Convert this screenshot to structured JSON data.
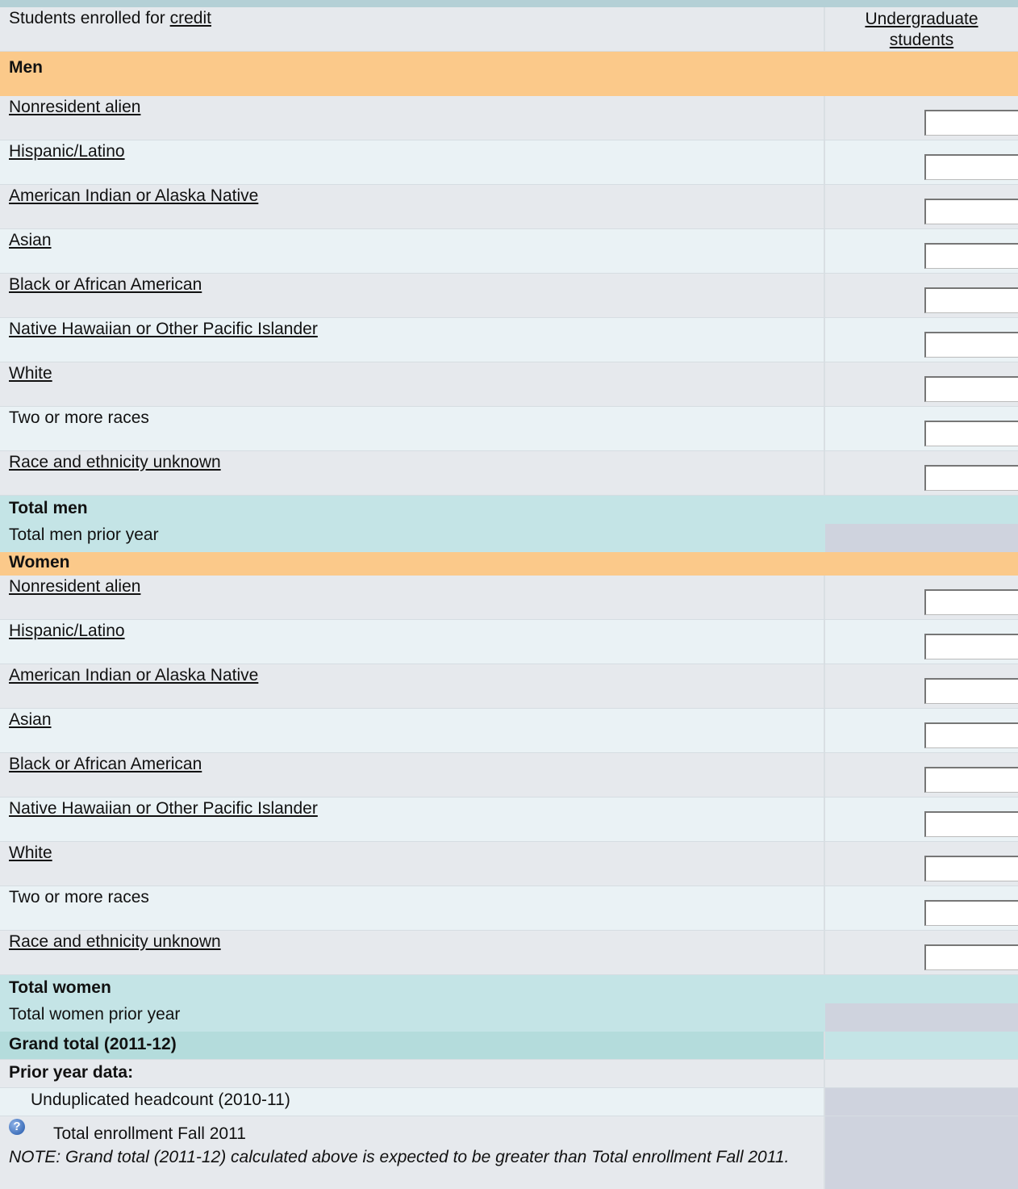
{
  "header": {
    "col1_prefix": "Students enrolled for ",
    "col1_link": "credit",
    "col2_line1": "Undergraduate",
    "col2_line2": "students"
  },
  "men": {
    "title": "Men",
    "rows": [
      {
        "label": "Nonresident alien",
        "linked": true
      },
      {
        "label": "Hispanic/Latino",
        "linked": true
      },
      {
        "label": "American Indian or Alaska Native",
        "linked": true
      },
      {
        "label": "Asian",
        "linked": true
      },
      {
        "label": "Black or African American",
        "linked": true
      },
      {
        "label": "Native Hawaiian or Other Pacific Islander",
        "linked": true
      },
      {
        "label": "White",
        "linked": true
      },
      {
        "label": "Two or more races",
        "linked": false
      },
      {
        "label": "Race and ethnicity unknown",
        "linked": true
      }
    ],
    "total_label": "Total men",
    "prior_label": "Total men prior year"
  },
  "women": {
    "title": "Women",
    "rows": [
      {
        "label": "Nonresident alien",
        "linked": true
      },
      {
        "label": "Hispanic/Latino",
        "linked": true
      },
      {
        "label": "American Indian or Alaska Native",
        "linked": true
      },
      {
        "label": "Asian",
        "linked": true
      },
      {
        "label": "Black or African American",
        "linked": true
      },
      {
        "label": "Native Hawaiian or Other Pacific Islander",
        "linked": true
      },
      {
        "label": "White",
        "linked": true
      },
      {
        "label": "Two or more races",
        "linked": false
      },
      {
        "label": "Race and ethnicity unknown",
        "linked": true
      }
    ],
    "total_label": "Total women",
    "prior_label": "Total women prior year"
  },
  "grand_total_label": "Grand total (2011-12)",
  "prior_year": {
    "title": "Prior year data:",
    "unduplicated_label": "Unduplicated headcount (2010-11)",
    "enrollment_label": "Total enrollment Fall 2011",
    "note": "NOTE: Grand total (2011-12) calculated above is expected to be greater than Total enrollment Fall 2011."
  },
  "icons": {
    "help": "help-icon"
  },
  "colors": {
    "section_header": "#fbc98a",
    "total_row": "#c4e4e6",
    "readonly_cell": "#cfd3de",
    "row_odd": "#e6e9ed",
    "row_even": "#eaf2f5"
  }
}
